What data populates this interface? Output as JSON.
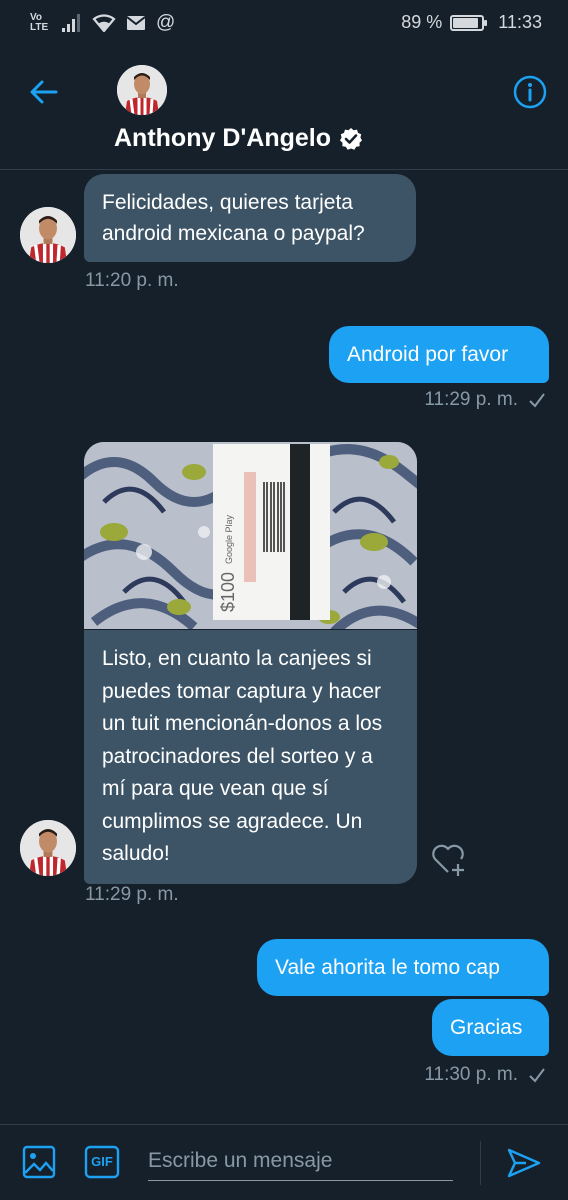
{
  "status_bar": {
    "network_label": "Vo\nLTE",
    "battery_percent": "89 %",
    "battery_level": 0.89,
    "time": "11:33"
  },
  "header": {
    "contact_name": "Anthony D'Angelo",
    "verified": true
  },
  "messages": [
    {
      "direction": "in",
      "text": "Felicidades, quieres tarjeta android mexicana o paypal?",
      "time": "11:20 p. m."
    },
    {
      "direction": "out",
      "text": "Android por favor",
      "time": "11:29 p. m."
    },
    {
      "direction": "in",
      "has_image": true,
      "text": "Listo, en cuanto la canjees si puedes tomar captura y hacer un tuit mencionán-donos a los patrocinadores del sorteo y a mí para que vean que sí cumplimos se agradece. Un saludo!",
      "time": "11:29 p. m."
    },
    {
      "direction": "out",
      "text": "Vale ahorita le tomo cap",
      "time": ""
    },
    {
      "direction": "out",
      "text": "Gracias",
      "time": "11:30 p. m."
    }
  ],
  "photo": {
    "card_amount": "$100",
    "card_brand": "Google Play"
  },
  "composer": {
    "placeholder": "Escribe un mensaje",
    "gif_label": "GIF"
  },
  "colors": {
    "background": "#15202b",
    "incoming_bubble": "#3d5466",
    "outgoing_bubble": "#1da1f2",
    "accent": "#1da1f2",
    "muted_text": "#8899a6"
  },
  "icons": [
    "back-arrow-icon",
    "info-icon",
    "verified-badge-icon",
    "checkmark-icon",
    "heart-plus-icon",
    "image-icon",
    "gif-icon",
    "send-icon",
    "signal-icon",
    "wifi-icon",
    "mail-icon",
    "at-icon",
    "battery-icon"
  ]
}
